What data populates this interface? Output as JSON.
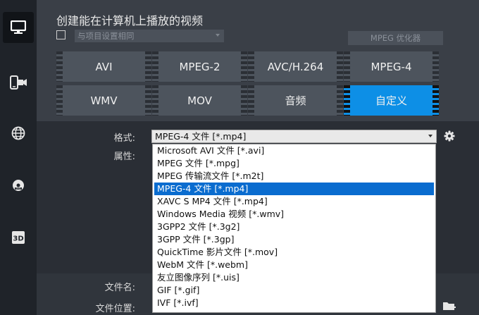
{
  "sidebar": {
    "items": [
      {
        "name": "computer",
        "icon": "monitor-icon",
        "active": true
      },
      {
        "name": "device",
        "icon": "device-icon",
        "active": false
      },
      {
        "name": "web",
        "icon": "globe-icon",
        "active": false
      },
      {
        "name": "disc",
        "icon": "disc-icon",
        "active": false
      },
      {
        "name": "3d",
        "icon": "3d-icon",
        "active": false
      }
    ]
  },
  "header": {
    "title": "创建能在计算机上播放的视频",
    "project_settings_label": "与项目设置相同",
    "mpeg_optimizer_label": "MPEG 优化器"
  },
  "formats": [
    {
      "label": "AVI",
      "selected": false
    },
    {
      "label": "MPEG-2",
      "selected": false
    },
    {
      "label": "AVC/H.264",
      "selected": false
    },
    {
      "label": "MPEG-4",
      "selected": false
    },
    {
      "label": "WMV",
      "selected": false
    },
    {
      "label": "MOV",
      "selected": false
    },
    {
      "label": "音频",
      "selected": false
    },
    {
      "label": "自定义",
      "selected": true
    }
  ],
  "form": {
    "format_label": "格式:",
    "properties_label": "属性:",
    "filename_label": "文件名:",
    "location_label": "文件位置:",
    "format_value": "MPEG-4 文件 [*.mp4]"
  },
  "dropdown": {
    "items": [
      "Microsoft AVI 文件 [*.avi]",
      "MPEG 文件 [*.mpg]",
      "MPEG 传输流文件 [*.m2t]",
      "MPEG-4 文件 [*.mp4]",
      "XAVC S MP4 文件 [*.mp4]",
      "Windows Media 视频 [*.wmv]",
      "3GPP2 文件 [*.3g2]",
      "3GPP 文件 [*.3gp]",
      "QuickTime 影片文件 [*.mov]",
      "WebM 文件 [*.webm]",
      "友立图像序列 [*.uis]",
      "GIF [*.gif]",
      "IVF [*.ivf]"
    ],
    "selected_index": 3
  },
  "colors": {
    "accent": "#0d8fe6",
    "selection": "#0a6ccf",
    "panel": "#3a3f47",
    "background": "#2a2e35"
  }
}
